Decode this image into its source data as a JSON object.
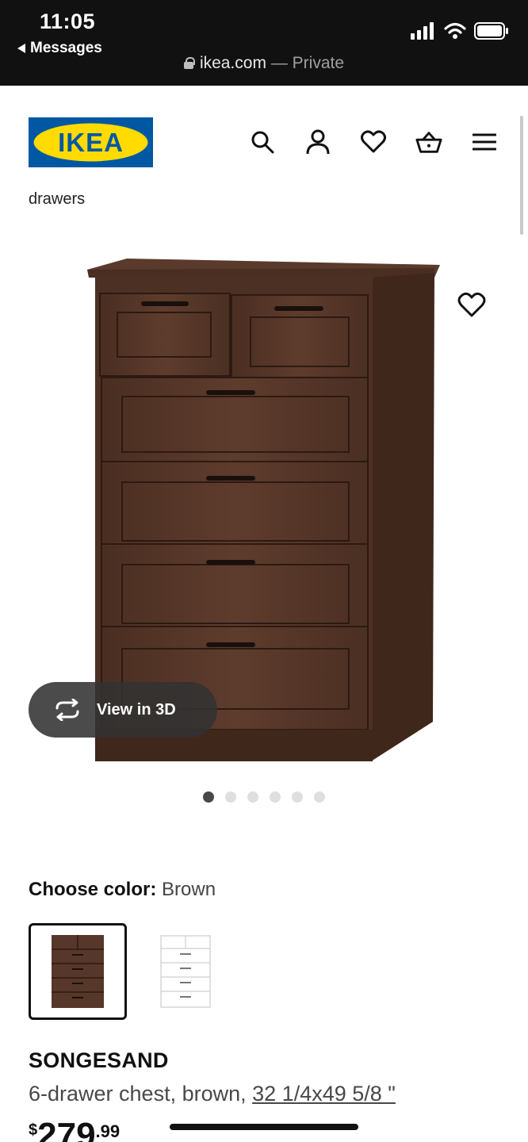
{
  "status_bar": {
    "time": "11:05",
    "back_label": "Messages",
    "domain": "ikea.com",
    "mode": "— Private",
    "icons": [
      "signal-icon",
      "wifi-icon",
      "battery-icon"
    ]
  },
  "header": {
    "logo_text": "IKEA",
    "icons": [
      "search-icon",
      "account-icon",
      "heart-icon",
      "basket-icon",
      "menu-icon"
    ],
    "brand_colors": {
      "blue": "#0058A3",
      "yellow": "#FFDB00"
    }
  },
  "breadcrumb": "drawers",
  "gallery": {
    "view_3d_label": "View in 3D",
    "image_count": 6,
    "active_index": 0
  },
  "color_picker": {
    "label": "Choose color:",
    "value": "Brown",
    "options": [
      {
        "name": "brown",
        "color": "#5a3a2c",
        "selected": true
      },
      {
        "name": "white",
        "color": "#ffffff",
        "selected": false
      }
    ]
  },
  "product": {
    "name": "SONGESAND",
    "description": "6-drawer chest, brown,",
    "dimensions": "32 1/4x49 5/8 \"",
    "price_currency": "$",
    "price_integer": "279",
    "price_decimal": ".99"
  }
}
